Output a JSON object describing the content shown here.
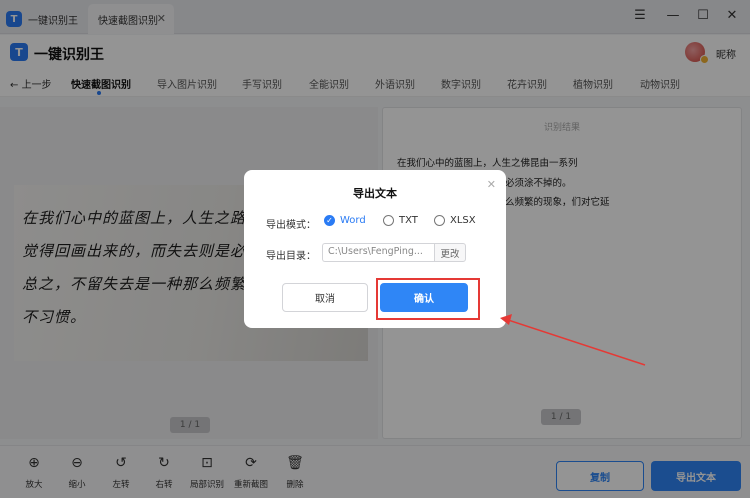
{
  "tabs": [
    {
      "label": "一键识别王"
    },
    {
      "label": "快速截图识别"
    }
  ],
  "app": {
    "logo_letter": "T",
    "title": "一键识别王",
    "nickname": "昵称"
  },
  "nav": {
    "back_label": "上一步",
    "modes": [
      "快速截图识别",
      "导入图片识别",
      "手写识别",
      "全能识别",
      "外语识别",
      "数字识别",
      "花卉识别",
      "植物识别",
      "动物识别"
    ]
  },
  "image_panel": {
    "handwriting": [
      "在我们心中的蓝图上，人生之路仍",
      "觉得回画出来的，而失去则是必须",
      "总之，不留失去是一种那么频繁的现",
      "不习惯。"
    ],
    "page_indicator": "1 / 1"
  },
  "result_panel": {
    "title": "识别结果",
    "lines": [
      "在我们心中的蓝图上，人生之佛昆由一系列",
      "必须涂不掉的。",
      "么频繁的现象，们对它延"
    ],
    "page_indicator": "1 / 1"
  },
  "dialog": {
    "title": "导出文本",
    "mode_label": "导出模式：",
    "options": [
      "Word",
      "TXT",
      "XLSX"
    ],
    "selected": "Word",
    "dir_label": "导出目录：",
    "path_value": "C:\\Users\\FengPing...",
    "change_label": "更改",
    "cancel_label": "取消",
    "confirm_label": "确认"
  },
  "toolbar": {
    "tools": [
      "放大",
      "缩小",
      "左转",
      "右转",
      "局部识别",
      "重新截图",
      "删除"
    ],
    "copy_label": "复制",
    "export_label": "导出文本"
  },
  "colors": {
    "accent": "#2f86f6",
    "highlight": "#e53935"
  }
}
